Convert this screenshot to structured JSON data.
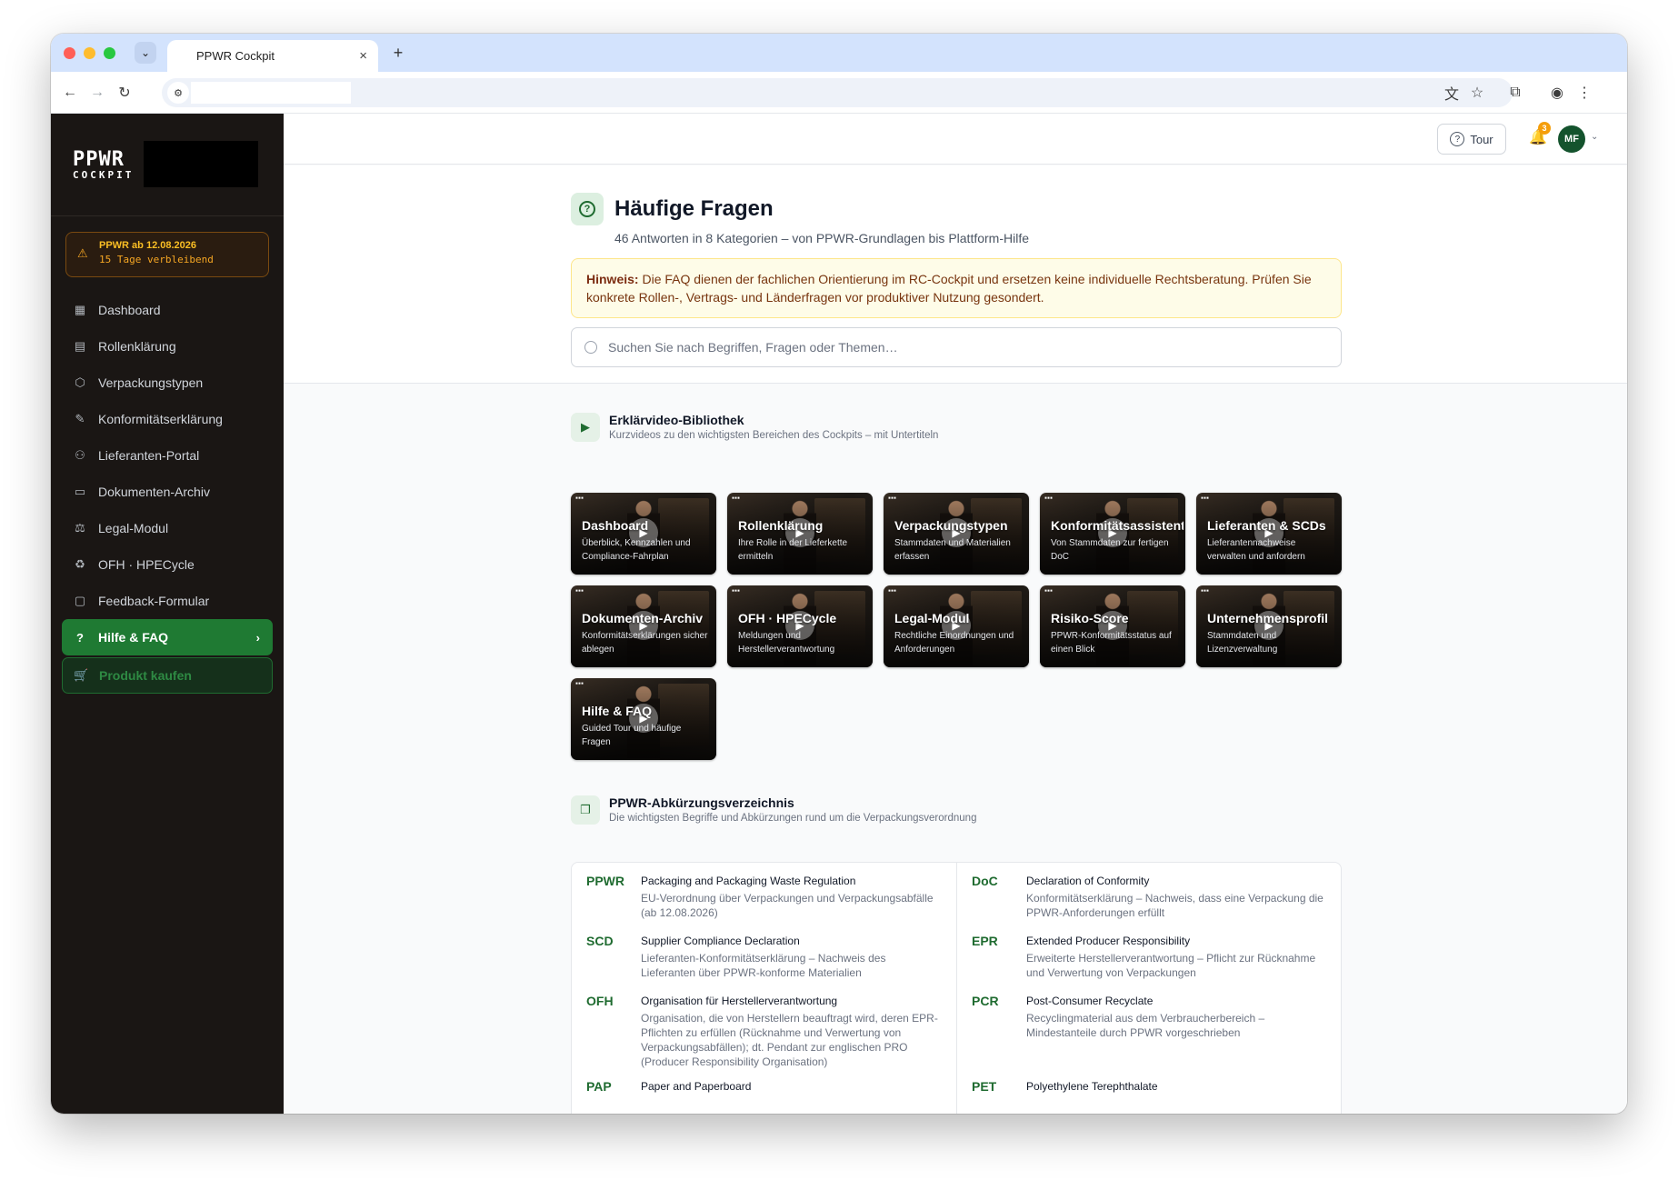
{
  "browser": {
    "tab_title": "PPWR Cockpit",
    "close_glyph": "×",
    "new_tab_glyph": "+"
  },
  "sidebar": {
    "logo_line1": "PPWR",
    "logo_line2": "COCKPIT",
    "deadline_title": "PPWR ab 12.08.2026",
    "deadline_remaining": "15 Tage verbleibend",
    "items": [
      {
        "label": "Dashboard",
        "icon": "grid-icon"
      },
      {
        "label": "Rollenklärung",
        "icon": "clipboard-icon"
      },
      {
        "label": "Verpackungstypen",
        "icon": "package-icon"
      },
      {
        "label": "Konformitätserklärung",
        "icon": "file-sign-icon"
      },
      {
        "label": "Lieferanten-Portal",
        "icon": "users-icon"
      },
      {
        "label": "Dokumenten-Archiv",
        "icon": "archive-icon"
      },
      {
        "label": "Legal-Modul",
        "icon": "scale-icon"
      },
      {
        "label": "OFH · HPECycle",
        "icon": "recycle-icon"
      },
      {
        "label": "Feedback-Formular",
        "icon": "message-icon"
      },
      {
        "label": "Hilfe & FAQ",
        "icon": "help-circle-icon",
        "active": true
      }
    ],
    "buy_label": "Produkt kaufen"
  },
  "topbar": {
    "tour_label": "Tour",
    "notification_count": "3",
    "avatar_initials": "MF"
  },
  "page": {
    "title": "Häufige Fragen",
    "subtitle": "46 Antworten in 8 Kategorien – von PPWR-Grundlagen bis Plattform-Hilfe",
    "notice_label": "Hinweis:",
    "notice_text": " Die FAQ dienen der fachlichen Orientierung im RC-Cockpit und ersetzen keine individuelle Rechtsberatung. Prüfen Sie konkrete Rollen-, Vertrags- und Länderfragen vor produktiver Nutzung gesondert.",
    "search_placeholder": "Suchen Sie nach Begriffen, Fragen oder Themen…"
  },
  "videos": {
    "title": "Erklärvideo-Bibliothek",
    "subtitle": "Kurzvideos zu den wichtigsten Bereichen des Cockpits – mit Untertiteln",
    "items": [
      {
        "title": "Dashboard",
        "desc": "Überblick, Kennzahlen und Compliance-Fahrplan"
      },
      {
        "title": "Rollenklärung",
        "desc": "Ihre Rolle in der Lieferkette ermitteln"
      },
      {
        "title": "Verpackungstypen",
        "desc": "Stammdaten und Materialien erfassen"
      },
      {
        "title": "Konformitätsassistent",
        "desc": "Von Stammdaten zur fertigen DoC"
      },
      {
        "title": "Lieferanten & SCDs",
        "desc": "Lieferantennachweise verwalten und anfordern"
      },
      {
        "title": "Dokumenten-Archiv",
        "desc": "Konformitätserklärungen sicher ablegen"
      },
      {
        "title": "OFH · HPECycle",
        "desc": "Meldungen und Herstellerverantwortung"
      },
      {
        "title": "Legal-Modul",
        "desc": "Rechtliche Einordnungen und Anforderungen"
      },
      {
        "title": "Risiko-Score",
        "desc": "PPWR-Konformitätsstatus auf einen Blick"
      },
      {
        "title": "Unternehmensprofil",
        "desc": "Stammdaten und Lizenzverwaltung"
      },
      {
        "title": "Hilfe & FAQ",
        "desc": "Guided Tour und häufige Fragen"
      }
    ]
  },
  "glossary": {
    "title": "PPWR-Abkürzungsverzeichnis",
    "subtitle": "Die wichtigsten Begriffe und Abkürzungen rund um die Verpackungsverordnung",
    "left": [
      {
        "key": "PPWR",
        "term": "Packaging and Packaging Waste Regulation",
        "desc": "EU-Verordnung über Verpackungen und Verpackungsabfälle (ab 12.08.2026)"
      },
      {
        "key": "SCD",
        "term": "Supplier Compliance Declaration",
        "desc": "Lieferanten-Konformitätserklärung – Nachweis des Lieferanten über PPWR-konforme Materialien"
      },
      {
        "key": "OFH",
        "term": "Organisation für Herstellerverantwortung",
        "desc": "Organisation, die von Herstellern beauftragt wird, deren EPR-Pflichten zu erfüllen (Rücknahme und Verwertung von Verpackungsabfällen); dt. Pendant zur englischen PRO (Producer Responsibility Organisation)"
      },
      {
        "key": "PAP",
        "term": "Paper and Paperboard",
        "desc": ""
      }
    ],
    "right": [
      {
        "key": "DoC",
        "term": "Declaration of Conformity",
        "desc": "Konformitätserklärung – Nachweis, dass eine Verpackung die PPWR-Anforderungen erfüllt"
      },
      {
        "key": "EPR",
        "term": "Extended Producer Responsibility",
        "desc": "Erweiterte Herstellerverantwortung – Pflicht zur Rücknahme und Verwertung von Verpackungen"
      },
      {
        "key": "PCR",
        "term": "Post-Consumer Recyclate",
        "desc": "Recyclingmaterial aus dem Verbraucherbereich – Mindestanteile durch PPWR vorgeschrieben"
      },
      {
        "key": "PET",
        "term": "Polyethylene Terephthalate",
        "desc": ""
      }
    ]
  },
  "colors": {
    "sidebar_bg": "#1a1614",
    "accent_green": "#1f7a33",
    "warning": "#f59e0b"
  }
}
